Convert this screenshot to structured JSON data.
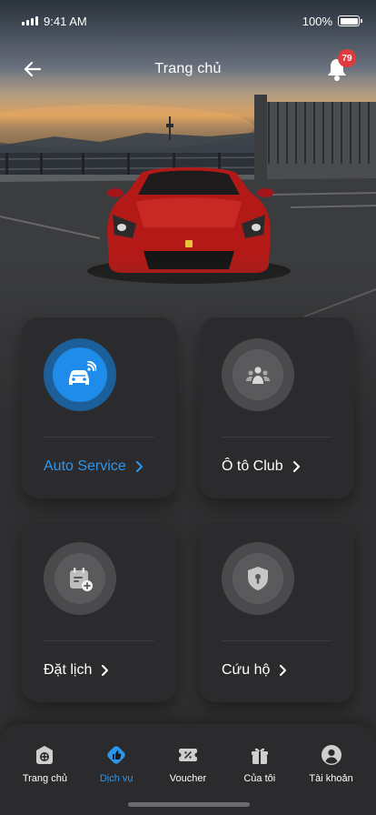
{
  "status_bar": {
    "time": "9:41 AM",
    "battery": "100%"
  },
  "header": {
    "title": "Trang chủ",
    "back_icon": "arrow-left-icon",
    "notification_icon": "bell-icon",
    "notification_count": "79"
  },
  "hero": {
    "image": "red sports car on parking deck at sunset"
  },
  "services": [
    {
      "label": "Auto Service",
      "icon": "car-wifi-icon",
      "active": true
    },
    {
      "label": "Ô tô Club",
      "icon": "group-people-icon",
      "active": false
    },
    {
      "label": "Đặt lịch",
      "icon": "calendar-add-icon",
      "active": false
    },
    {
      "label": "Cứu hộ",
      "icon": "shield-lock-icon",
      "active": false
    }
  ],
  "bottom_nav": [
    {
      "label": "Trang chủ",
      "icon": "home-icon",
      "active": false
    },
    {
      "label": "Dịch vụ",
      "icon": "service-thumb-icon",
      "active": true
    },
    {
      "label": "Voucher",
      "icon": "voucher-icon",
      "active": false
    },
    {
      "label": "Của tôi",
      "icon": "gift-box-icon",
      "active": false
    },
    {
      "label": "Tài khoản",
      "icon": "account-icon",
      "active": false
    }
  ],
  "colors": {
    "accent": "#2a96f0",
    "background": "#2f2f31",
    "card": "#2b2b2d",
    "badge": "#e03a3e"
  }
}
